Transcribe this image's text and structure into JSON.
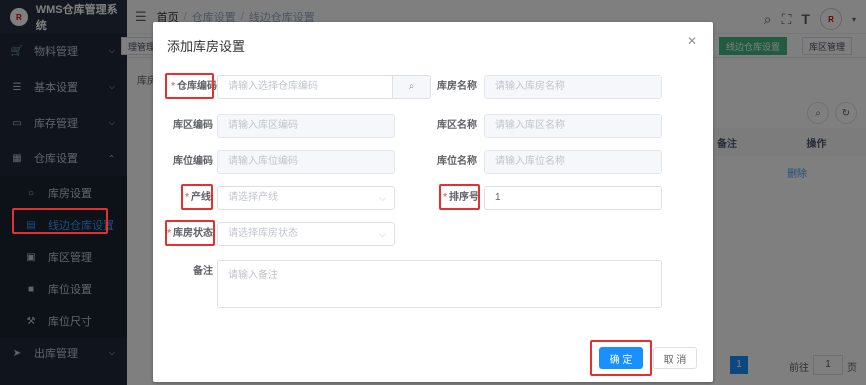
{
  "app": {
    "title": "WMS仓库管理系统",
    "logo_text": "Ruitai"
  },
  "sidebar": {
    "items": [
      {
        "label": "物料管理",
        "icon": "cart-icon"
      },
      {
        "label": "基本设置",
        "icon": "sliders-icon"
      },
      {
        "label": "库存管理",
        "icon": "monitor-icon"
      },
      {
        "label": "仓库设置",
        "icon": "grid-icon"
      },
      {
        "label": "库房设置",
        "icon": "circle-icon"
      },
      {
        "label": "线边仓库设置",
        "icon": "document-icon"
      },
      {
        "label": "库区管理",
        "icon": "square-icon"
      },
      {
        "label": "库位设置",
        "icon": "box-icon"
      },
      {
        "label": "库位尺寸",
        "icon": "fork-icon"
      },
      {
        "label": "出库管理",
        "icon": "send-icon"
      }
    ]
  },
  "header": {
    "breadcrumb": [
      "首页",
      "仓库设置",
      "线边仓库设置"
    ],
    "sep": "/"
  },
  "tags": {
    "left_partial": "理管理",
    "active": "线边仓库设置",
    "right": "库区管理"
  },
  "background": {
    "label": "库房",
    "col_note": "备注",
    "col_action": "操作",
    "row_action": "删除",
    "pagination": {
      "current": "1",
      "goto": "前往",
      "page_value": "1",
      "page_unit": "页"
    }
  },
  "dialog": {
    "title": "添加库房设置",
    "fields": {
      "warehouse_code": {
        "label": "仓库编码",
        "placeholder": "请输入选择仓库编码"
      },
      "warehouse_name": {
        "label": "库房名称",
        "placeholder": "请输入库房名称"
      },
      "area_code": {
        "label": "库区编码",
        "placeholder": "请输入库区编码"
      },
      "area_name": {
        "label": "库区名称",
        "placeholder": "请输入库区名称"
      },
      "location_code": {
        "label": "库位编码",
        "placeholder": "请输入库位编码"
      },
      "location_name": {
        "label": "库位名称",
        "placeholder": "请输入库位名称"
      },
      "production_line": {
        "label": "产线",
        "placeholder": "请选择产线"
      },
      "sort_order": {
        "label": "排序号",
        "value": "1"
      },
      "status": {
        "label": "库房状态",
        "placeholder": "请选择库房状态"
      },
      "remark": {
        "label": "备注",
        "placeholder": "请输入备注"
      }
    },
    "confirm": "确 定",
    "cancel": "取 消",
    "required_mark": "*"
  }
}
